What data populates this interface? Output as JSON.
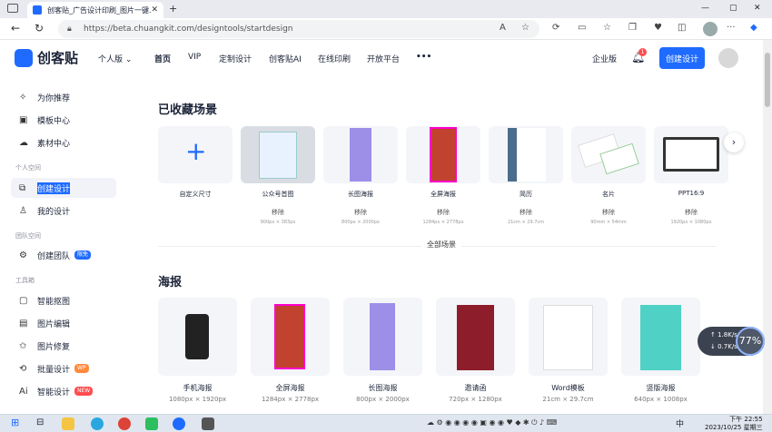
{
  "browser": {
    "tab_title": "创客贴_广告设计印刷_图片一键...",
    "url": "https://beta.chuangkit.com/designtools/startdesign"
  },
  "header": {
    "brand": "创客贴",
    "version": "个人版",
    "nav": [
      "首页",
      "VIP",
      "定制设计",
      "创客贴AI",
      "在线印刷",
      "开放平台"
    ],
    "more": "•••",
    "enterprise": "企业版",
    "bell_badge": "1",
    "create_button": "创建设计"
  },
  "sidebar": {
    "items_top": [
      "为你推荐",
      "模板中心",
      "素材中心"
    ],
    "group_personal": "个人空间",
    "personal_items": [
      "创建设计",
      "我的设计"
    ],
    "group_team": "团队空间",
    "team_item": "创建团队",
    "team_tag": "限免",
    "group_tools": "工具箱",
    "tools": [
      {
        "label": "智能抠图",
        "tag": ""
      },
      {
        "label": "图片编辑",
        "tag": ""
      },
      {
        "label": "图片修复",
        "tag": ""
      },
      {
        "label": "批量设计",
        "tag": "WP"
      },
      {
        "label": "智能设计",
        "tag": "NEW"
      }
    ]
  },
  "favorites": {
    "title": "已收藏场景",
    "remove_label": "移除",
    "custom_label": "自定义尺寸",
    "items": [
      {
        "label": "公众号首图",
        "size": "900px × 383px"
      },
      {
        "label": "长图海报",
        "size": "800px × 2000px"
      },
      {
        "label": "全屏海报",
        "size": "1284px × 2778px"
      },
      {
        "label": "简历",
        "size": "21cm × 29.7cm"
      },
      {
        "label": "名片",
        "size": "90mm × 54mm"
      },
      {
        "label": "PPT16:9",
        "size": "1920px × 1080px"
      }
    ],
    "all_scenes": "全部场景"
  },
  "posters": {
    "title": "海报",
    "items": [
      {
        "label": "手机海报",
        "size": "1080px × 1920px"
      },
      {
        "label": "全屏海报",
        "size": "1284px × 2778px"
      },
      {
        "label": "长图海报",
        "size": "800px × 2000px"
      },
      {
        "label": "邀请函",
        "size": "720px × 1280px"
      },
      {
        "label": "Word模板",
        "size": "21cm × 29.7cm"
      },
      {
        "label": "竖版海报",
        "size": "640px × 1008px"
      }
    ]
  },
  "netspeed": {
    "up": "1.8",
    "down": "0.7",
    "unit": "K/s",
    "percent": "77"
  },
  "taskbar": {
    "time": "下午 22:55",
    "date": "2023/10/25 星期三",
    "ime": "中"
  }
}
